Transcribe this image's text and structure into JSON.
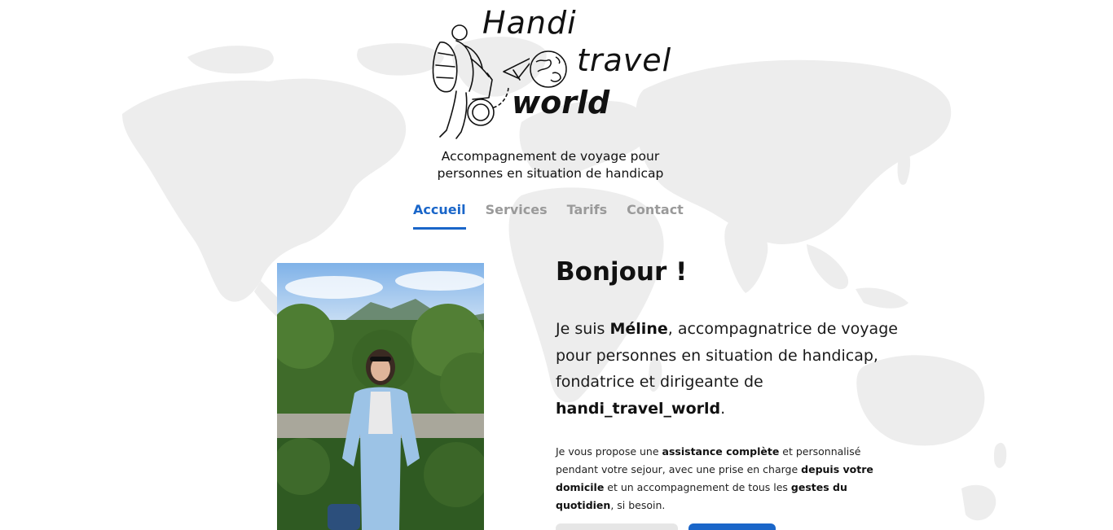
{
  "brand": {
    "logo_line1": "Handi",
    "logo_line2": "travel",
    "logo_line3": "world",
    "tagline_line1": "Accompagnement de voyage pour",
    "tagline_line2": "personnes en situation de handicap"
  },
  "nav": {
    "items": [
      {
        "label": "Accueil",
        "active": true
      },
      {
        "label": "Services",
        "active": false
      },
      {
        "label": "Tarifs",
        "active": false
      },
      {
        "label": "Contact",
        "active": false
      }
    ]
  },
  "hero": {
    "greeting": "Bonjour !",
    "intro": {
      "prefix": "Je suis ",
      "name": "Méline",
      "middle": ", accompagnatrice de voyage pour personnes en situation de handicap, fondatrice et dirigeante de ",
      "company": "handi_travel_world",
      "suffix": "."
    },
    "detail": {
      "p1": "Je vous propose une ",
      "b1": "assistance complète",
      "p2": " et personnalisé pendant votre sejour, avec une prise en charge ",
      "b2": "depuis votre domicile",
      "p3": " et un accompagnement de tous les ",
      "b3": "gestes du quotidien",
      "p4": ", si besoin."
    }
  },
  "colors": {
    "accent": "#1a66c9",
    "nav_inactive": "#9a9a9a",
    "map": "#ececec"
  }
}
